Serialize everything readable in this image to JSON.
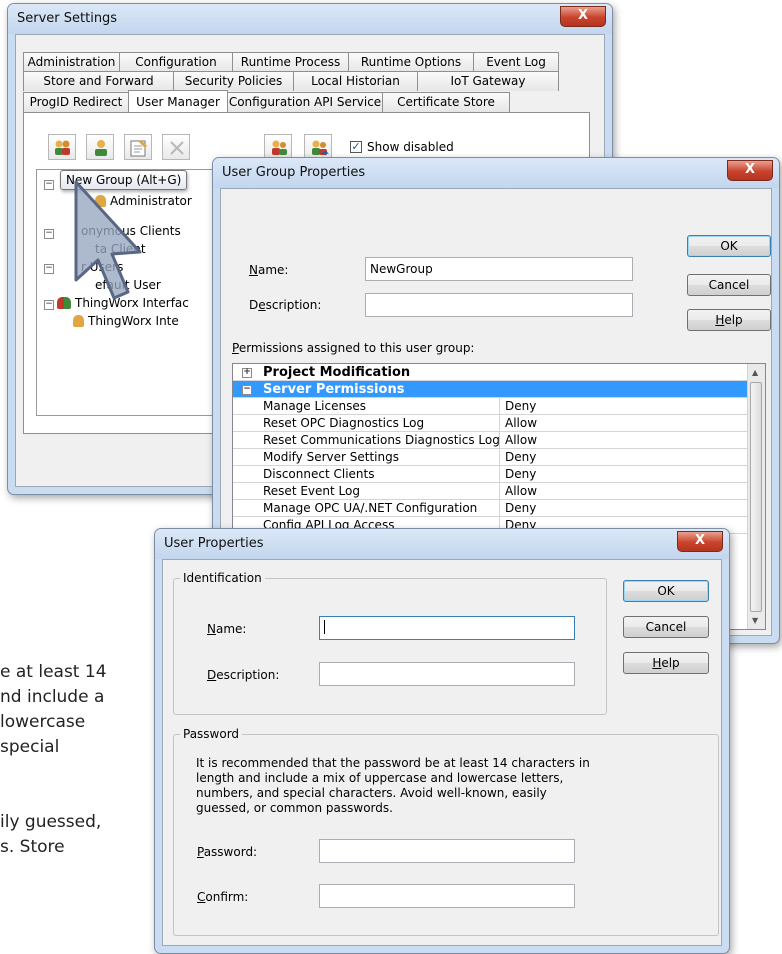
{
  "background_text": [
    "e at least 14",
    "nd include a",
    "lowercase",
    "special",
    "",
    "ily guessed,",
    "s. Store"
  ],
  "server_settings": {
    "title": "Server Settings",
    "close": "X",
    "tabs_row1": [
      "Administration",
      "Configuration",
      "Runtime Process",
      "Runtime Options",
      "Event Log"
    ],
    "tabs_row2": [
      "Store and Forward Service",
      "Security Policies",
      "Local Historian",
      "IoT Gateway"
    ],
    "tabs_row3": [
      "ProgID Redirect",
      "User Manager",
      "Configuration API Service",
      "Certificate Store"
    ],
    "selected_tab": "User Manager",
    "show_disabled_label": "Show disabled",
    "show_disabled_checked": "✓",
    "tooltip": "New Group (Alt+G)",
    "tree": [
      {
        "label": "Administrator",
        "level": 1
      },
      {
        "label": "onymous Clients",
        "level": 0
      },
      {
        "label": "ta Client",
        "level": 1
      },
      {
        "label": "r Users",
        "level": 0
      },
      {
        "label": "efault User",
        "level": 1
      },
      {
        "label": "ThingWorx Interfac",
        "level": 0
      },
      {
        "label": "ThingWorx Inte",
        "level": 1
      }
    ]
  },
  "group_props": {
    "title": "User Group Properties",
    "close": "X",
    "name_label_u": "N",
    "name_label_rest": "ame:",
    "name_value": "NewGroup",
    "desc_label_pre": "D",
    "desc_label_u": "e",
    "desc_label_rest": "scription:",
    "perms_label_u": "P",
    "perms_label_rest": "ermissions assigned to this user group:",
    "ok": "OK",
    "cancel": "Cancel",
    "help_u": "H",
    "help_rest": "elp",
    "sections": [
      {
        "sign": "+",
        "label": "Project Modification"
      },
      {
        "sign": "−",
        "label": "Server Permissions"
      }
    ],
    "permissions": [
      {
        "name": "Manage Licenses",
        "value": "Deny"
      },
      {
        "name": "Reset OPC Diagnostics Log",
        "value": "Allow"
      },
      {
        "name": "Reset Communications Diagnostics Log",
        "value": "Allow"
      },
      {
        "name": "Modify Server Settings",
        "value": "Deny"
      },
      {
        "name": "Disconnect Clients",
        "value": "Deny"
      },
      {
        "name": "Reset Event Log",
        "value": "Allow"
      },
      {
        "name": "Manage OPC UA/.NET Configuration",
        "value": "Deny"
      },
      {
        "name": "Config API Log Access",
        "value": "Deny"
      }
    ]
  },
  "user_props": {
    "title": "User Properties",
    "close": "X",
    "identification_label": "Identification",
    "name_label_u": "N",
    "name_label_rest": "ame:",
    "desc_label_u": "D",
    "desc_label_rest": "escription:",
    "password_group_label": "Password",
    "password_text": [
      "It is recommended that the password be at least 14 characters in",
      "length and include a mix of uppercase and lowercase letters,",
      "numbers, and special characters. Avoid well-known, easily",
      "guessed, or common passwords."
    ],
    "password_label_u": "P",
    "password_label_rest": "assword:",
    "confirm_label_u": "C",
    "confirm_label_rest": "onfirm:",
    "ok": "OK",
    "cancel": "Cancel",
    "help_u": "H",
    "help_rest": "elp"
  }
}
